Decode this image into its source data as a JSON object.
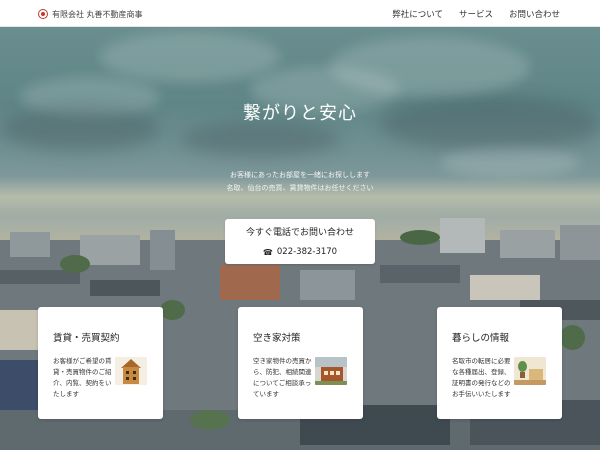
{
  "header": {
    "company_name": "有限会社 丸善不動産商事",
    "nav": {
      "about": "弊社について",
      "services": "サービス",
      "contact": "お問い合わせ"
    }
  },
  "hero": {
    "title": "繋がりと安心",
    "subtitle_line1": "お客様にあったお部屋を一緒にお探しします",
    "subtitle_line2": "名取、仙台の売買、賃貸物件はお任せください"
  },
  "contact": {
    "label": "今すぐ電話でお問い合わせ",
    "phone_icon": "☎",
    "phone": "022-382-3170"
  },
  "cards": [
    {
      "title": "賃貸・売買契約",
      "description": "お客様がご希望の賃貸・売買物件のご紹介、内覧、契約をいたします",
      "icon": "house-illustration"
    },
    {
      "title": "空き家対策",
      "description": "空き家物件の売買から、防犯、相続関連についてご相談承っています",
      "icon": "vacant-house-illustration"
    },
    {
      "title": "暮らしの情報",
      "description": "名取市の転居に必要な各種届出、登録、証明書の発行などのお手伝いいたします",
      "icon": "living-illustration"
    }
  ],
  "colors": {
    "logo_red": "#c0392b",
    "header_bg": "#ffffff",
    "card_bg": "#ffffff",
    "text_dark": "#222222"
  }
}
